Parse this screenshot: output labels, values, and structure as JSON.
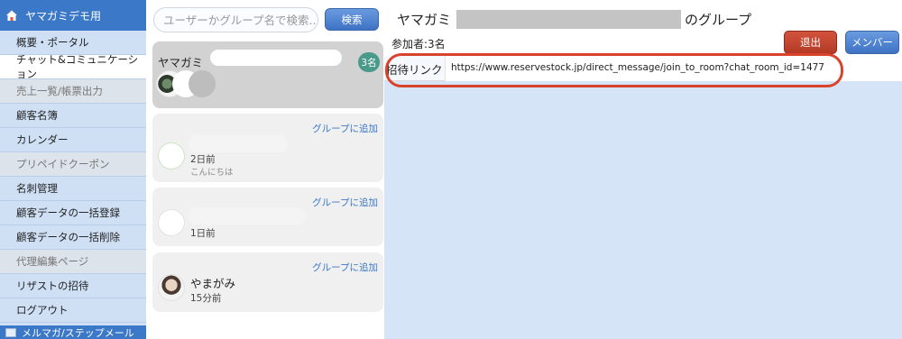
{
  "sidebar": {
    "header": "ヤマガミデモ用",
    "items": [
      {
        "label": "概要・ポータル",
        "state": "normal"
      },
      {
        "label": "チャット&コミュニケーション",
        "state": "active"
      },
      {
        "label": "売上一覧/帳票出力",
        "state": "disabled"
      },
      {
        "label": "顧客名簿",
        "state": "normal"
      },
      {
        "label": "カレンダー",
        "state": "normal"
      },
      {
        "label": "プリペイドクーポン",
        "state": "disabled"
      },
      {
        "label": "名刺管理",
        "state": "normal"
      },
      {
        "label": "顧客データの一括登録",
        "state": "normal"
      },
      {
        "label": "顧客データの一括削除",
        "state": "normal"
      },
      {
        "label": "代理編集ページ",
        "state": "disabled"
      },
      {
        "label": "リザストの招待",
        "state": "normal"
      },
      {
        "label": "ログアウト",
        "state": "normal"
      }
    ],
    "footer": "メルマガ/ステップメール"
  },
  "search": {
    "placeholder": "ユーザーかグループ名で検索...",
    "button_label": "検索"
  },
  "chat_list": [
    {
      "name": "ヤマガミ",
      "badge": "3名",
      "selected": true
    },
    {
      "add_label": "グループに追加",
      "time": "2日前",
      "preview": "こんにちは"
    },
    {
      "add_label": "グループに追加",
      "time": "1日前"
    },
    {
      "add_label": "グループに追加",
      "name": "やまがみ",
      "time": "15分前"
    }
  ],
  "room": {
    "title_prefix": "ヤマガミ",
    "title_suffix": "のグループ",
    "members": "参加者:3名",
    "leave_label": "退出",
    "member_label": "メンバー",
    "invite_label": "招待リンク",
    "invite_url": "https://www.reservestock.jp/direct_message/join_to_room?chat_room_id=1477"
  },
  "colors": {
    "sidebar_bg": "#cfe0f5",
    "primary": "#3b78c8",
    "danger": "#c0432f",
    "badge": "#4a9a8c",
    "highlight": "#d9432b"
  }
}
